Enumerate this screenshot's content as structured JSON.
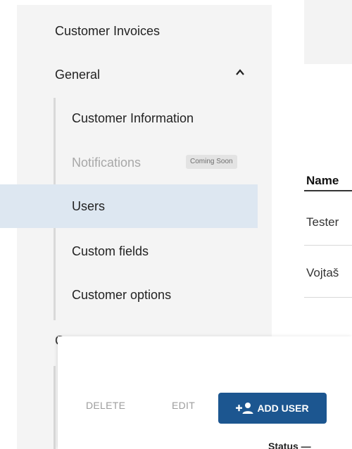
{
  "sidebar": {
    "customer_invoices": "Customer Invoices",
    "general": "General",
    "items": [
      {
        "label": "Customer Information"
      },
      {
        "label": "Notifications",
        "badge": "Coming Soon"
      },
      {
        "label": "Users"
      },
      {
        "label": "Custom fields"
      },
      {
        "label": "Customer options"
      }
    ],
    "partial_next": "C"
  },
  "main": {
    "column_header": "Name",
    "rows": [
      "Tester",
      "Vojtaš"
    ]
  },
  "overlay": {
    "delete_label": "DELETE",
    "edit_label": "EDIT",
    "add_user_label": "ADD USER",
    "status_label": "Status —"
  },
  "icons": {
    "caret": "chevron-up-icon",
    "add_user": "person-add-icon"
  },
  "colors": {
    "primary": "#1c5690",
    "selected_bg": "#dde7f1",
    "sidebar_bg": "#f4f4f4"
  }
}
